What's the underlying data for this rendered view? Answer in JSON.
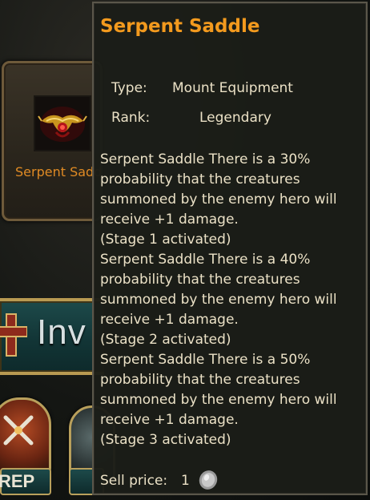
{
  "background": {
    "item_card_name": "Serpent Saddle",
    "banner_text": "Inv",
    "badge_label": "REP"
  },
  "tooltip": {
    "title": "Serpent Saddle",
    "type_label": "Type:",
    "type_value": "Mount Equipment",
    "rank_label": "Rank:",
    "rank_value": "Legendary",
    "description_lines": [
      "Serpent Saddle There is a 30%",
      "probability that the creatures",
      "summoned by the enemy hero will",
      "receive +1 damage.",
      "(Stage 1 activated)",
      "Serpent Saddle There is a 40%",
      "probability that the creatures",
      "summoned by the enemy hero will",
      "receive +1 damage.",
      "(Stage 2 activated)",
      "Serpent Saddle There is a 50%",
      "probability that the creatures",
      "summoned by the enemy hero will",
      "receive +1 damage.",
      "(Stage 3 activated)"
    ],
    "sell_label": "Sell price:",
    "sell_value": "1",
    "currency_icon": "silver-coin-icon"
  },
  "colors": {
    "title_orange": "#f39a1e",
    "text_cream": "#ebe1c6",
    "item_name_orange": "#e08a24",
    "tooltip_bg": "#1b1d18"
  }
}
